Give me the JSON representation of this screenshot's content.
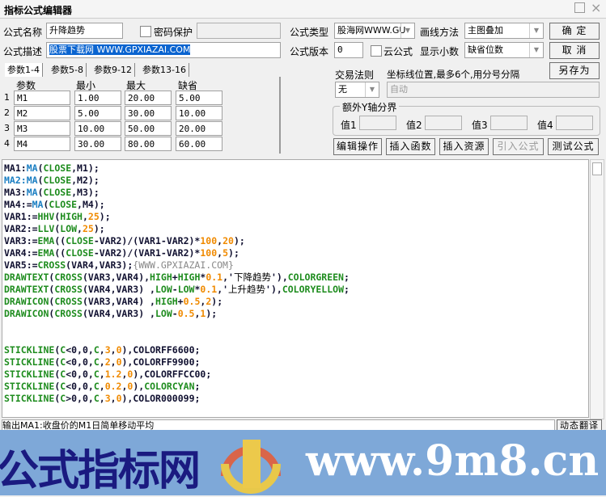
{
  "window": {
    "title": "指标公式编辑器"
  },
  "form": {
    "name_label": "公式名称",
    "name_value": "升降趋势",
    "password_label": "密码保护",
    "desc_label": "公式描述",
    "desc_value": "股票下载网 WWW.GPXIAZAI.COM",
    "type_label": "公式类型",
    "type_value": "股海网WWW.GU",
    "version_label": "公式版本",
    "version_value": "0",
    "cloud_label": "云公式",
    "draw_label": "画线方法",
    "draw_value": "主图叠加",
    "decimal_label": "显示小数",
    "decimal_value": "缺省位数",
    "trade_label": "交易法则",
    "trade_value": "无",
    "axis_label": "坐标线位置,最多6个,用分号分隔",
    "axis_placeholder": "自动",
    "yaxis_label": "额外Y轴分界",
    "values": [
      "值1",
      "值2",
      "值3",
      "值4"
    ]
  },
  "buttons": {
    "ok": "确  定",
    "cancel": "取  消",
    "save_as": "另存为",
    "edit": "编辑操作",
    "insert_func": "插入函数",
    "insert_res": "插入资源",
    "import": "引入公式",
    "test": "测试公式",
    "translate": "动态翻译"
  },
  "tabs": [
    "参数1-4",
    "参数5-8",
    "参数9-12",
    "参数13-16"
  ],
  "params": {
    "headers": [
      "参数",
      "最小",
      "最大",
      "缺省"
    ],
    "rows": [
      [
        "1",
        "M1",
        "1.00",
        "20.00",
        "5.00"
      ],
      [
        "2",
        "M2",
        "5.00",
        "30.00",
        "10.00"
      ],
      [
        "3",
        "M3",
        "10.00",
        "50.00",
        "20.00"
      ],
      [
        "4",
        "M4",
        "30.00",
        "80.00",
        "60.00"
      ]
    ]
  },
  "code": [
    [
      [
        "MA1:",
        "k"
      ],
      [
        "MA",
        "b"
      ],
      [
        "(",
        "k"
      ],
      [
        "CLOSE",
        "f"
      ],
      [
        ",M1);",
        "k"
      ]
    ],
    [
      [
        "MA2:",
        "b"
      ],
      [
        "MA",
        "b"
      ],
      [
        "(",
        "k"
      ],
      [
        "CLOSE",
        "f"
      ],
      [
        ",M2);",
        "k"
      ]
    ],
    [
      [
        "MA3:",
        "k"
      ],
      [
        "MA",
        "b"
      ],
      [
        "(",
        "k"
      ],
      [
        "CLOSE",
        "f"
      ],
      [
        ",M3);",
        "k"
      ]
    ],
    [
      [
        "MA4:=",
        "k"
      ],
      [
        "MA",
        "b"
      ],
      [
        "(",
        "k"
      ],
      [
        "CLOSE",
        "f"
      ],
      [
        ",M4);",
        "k"
      ]
    ],
    [
      [
        "VAR1:=",
        "k"
      ],
      [
        "HHV",
        "f"
      ],
      [
        "(",
        "k"
      ],
      [
        "HIGH",
        "f"
      ],
      [
        ",",
        "k"
      ],
      [
        "25",
        "n"
      ],
      [
        ");",
        "k"
      ]
    ],
    [
      [
        "VAR2:=",
        "k"
      ],
      [
        "LLV",
        "f"
      ],
      [
        "(",
        "k"
      ],
      [
        "LOW",
        "f"
      ],
      [
        ",",
        "k"
      ],
      [
        "25",
        "n"
      ],
      [
        ");",
        "k"
      ]
    ],
    [
      [
        "VAR3:=",
        "k"
      ],
      [
        "EMA",
        "f"
      ],
      [
        "((",
        "k"
      ],
      [
        "CLOSE",
        "f"
      ],
      [
        "-VAR2)/(VAR1-VAR2)*",
        "k"
      ],
      [
        "100",
        "n"
      ],
      [
        ",",
        "k"
      ],
      [
        "20",
        "n"
      ],
      [
        ");",
        "k"
      ]
    ],
    [
      [
        "VAR4:=",
        "k"
      ],
      [
        "EMA",
        "f"
      ],
      [
        "((",
        "k"
      ],
      [
        "CLOSE",
        "f"
      ],
      [
        "-VAR2)/(VAR1-VAR2)*",
        "k"
      ],
      [
        "100",
        "n"
      ],
      [
        ",",
        "k"
      ],
      [
        "5",
        "n"
      ],
      [
        ");",
        "k"
      ]
    ],
    [
      [
        "VAR5:=",
        "k"
      ],
      [
        "CROSS",
        "f"
      ],
      [
        "(VAR4,VAR3);",
        "k"
      ],
      [
        "{WWW.GPXIAZAI.COM}",
        "c"
      ]
    ],
    [
      [
        "DRAWTEXT",
        "f"
      ],
      [
        "(",
        "k"
      ],
      [
        "CROSS",
        "f"
      ],
      [
        "(VAR3,VAR4),",
        "k"
      ],
      [
        "HIGH",
        "f"
      ],
      [
        "+",
        "k"
      ],
      [
        "HIGH",
        "f"
      ],
      [
        "*",
        "k"
      ],
      [
        "0.1",
        "n"
      ],
      [
        ",'",
        "k"
      ],
      [
        "下降趋势",
        "s"
      ],
      [
        "'),",
        "k"
      ],
      [
        "COLORGREEN",
        "f"
      ],
      [
        ";",
        "k"
      ]
    ],
    [
      [
        "DRAWTEXT",
        "f"
      ],
      [
        "(",
        "k"
      ],
      [
        "CROSS",
        "f"
      ],
      [
        "(VAR4,VAR3) ,",
        "k"
      ],
      [
        "LOW",
        "f"
      ],
      [
        "-",
        "k"
      ],
      [
        "LOW",
        "f"
      ],
      [
        "*",
        "k"
      ],
      [
        "0.1",
        "n"
      ],
      [
        ",'",
        "k"
      ],
      [
        "上升趋势",
        "s"
      ],
      [
        "'),",
        "k"
      ],
      [
        "COLORYELLOW",
        "f"
      ],
      [
        ";",
        "k"
      ]
    ],
    [
      [
        "DRAWICON",
        "f"
      ],
      [
        "(",
        "k"
      ],
      [
        "CROSS",
        "f"
      ],
      [
        "(VAR3,VAR4) ,",
        "k"
      ],
      [
        "HIGH",
        "f"
      ],
      [
        "+",
        "k"
      ],
      [
        "0.5",
        "n"
      ],
      [
        ",",
        "k"
      ],
      [
        "2",
        "n"
      ],
      [
        ");",
        "k"
      ]
    ],
    [
      [
        "DRAWICON",
        "f"
      ],
      [
        "(",
        "k"
      ],
      [
        "CROSS",
        "f"
      ],
      [
        "(VAR4,VAR3) ,",
        "k"
      ],
      [
        "LOW",
        "f"
      ],
      [
        "-",
        "k"
      ],
      [
        "0.5",
        "n"
      ],
      [
        ",",
        "k"
      ],
      [
        "1",
        "n"
      ],
      [
        ");",
        "k"
      ]
    ],
    [],
    [],
    [
      [
        "STICKLINE",
        "f"
      ],
      [
        "(",
        "k"
      ],
      [
        "C",
        "f"
      ],
      [
        "<0,0,",
        "k"
      ],
      [
        "C",
        "f"
      ],
      [
        ",",
        "k"
      ],
      [
        "3",
        "n"
      ],
      [
        ",",
        "k"
      ],
      [
        "0",
        "n"
      ],
      [
        "),COLORFF6600;",
        "k"
      ]
    ],
    [
      [
        "STICKLINE",
        "f"
      ],
      [
        "(",
        "k"
      ],
      [
        "C",
        "f"
      ],
      [
        "<0,0,",
        "k"
      ],
      [
        "C",
        "f"
      ],
      [
        ",",
        "k"
      ],
      [
        "2",
        "n"
      ],
      [
        ",",
        "k"
      ],
      [
        "0",
        "n"
      ],
      [
        "),COLORFF9900;",
        "k"
      ]
    ],
    [
      [
        "STICKLINE",
        "f"
      ],
      [
        "(",
        "k"
      ],
      [
        "C",
        "f"
      ],
      [
        "<0,0,",
        "k"
      ],
      [
        "C",
        "f"
      ],
      [
        ",",
        "k"
      ],
      [
        "1.2",
        "n"
      ],
      [
        ",",
        "k"
      ],
      [
        "0",
        "n"
      ],
      [
        "),COLORFFCC00;",
        "k"
      ]
    ],
    [
      [
        "STICKLINE",
        "f"
      ],
      [
        "(",
        "k"
      ],
      [
        "C",
        "f"
      ],
      [
        "<0,0,",
        "k"
      ],
      [
        "C",
        "f"
      ],
      [
        ",",
        "k"
      ],
      [
        "0.2",
        "n"
      ],
      [
        ",",
        "k"
      ],
      [
        "0",
        "n"
      ],
      [
        "),",
        "k"
      ],
      [
        "COLORCYAN",
        "f"
      ],
      [
        ";",
        "k"
      ]
    ],
    [
      [
        "STICKLINE",
        "f"
      ],
      [
        "(",
        "k"
      ],
      [
        "C",
        "f"
      ],
      [
        ">0,0,",
        "k"
      ],
      [
        "C",
        "f"
      ],
      [
        ",",
        "k"
      ],
      [
        "3",
        "n"
      ],
      [
        ",",
        "k"
      ],
      [
        "0",
        "n"
      ],
      [
        "),COLOR000099;",
        "k"
      ]
    ]
  ],
  "status": "输出MA1:收盘价的M1日简单移动平均",
  "watermark": {
    "left": "公式指标网",
    "right": "www.9m8.cn",
    "logo": "9m8.cn"
  }
}
